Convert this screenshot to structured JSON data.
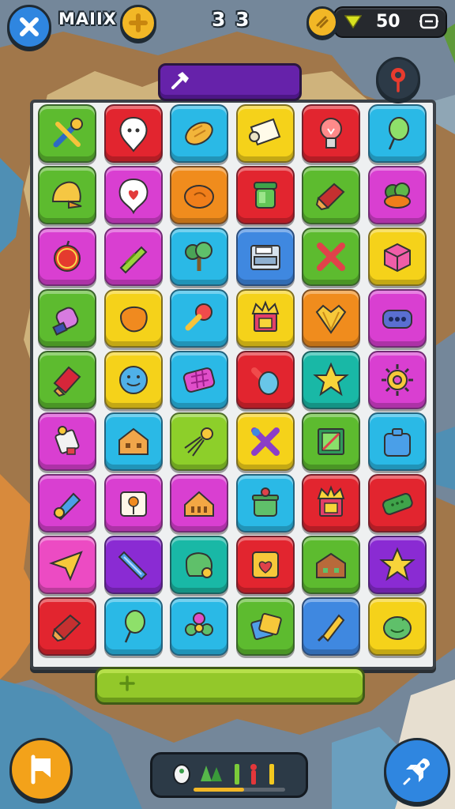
{
  "hud": {
    "title": "MAIIX",
    "score": "3 3",
    "coins": "50"
  },
  "colors": {
    "green": "#5dbb2f",
    "red": "#e2252f",
    "cyan": "#2ab9e6",
    "yellow": "#f5d21a",
    "orange": "#f08c1d",
    "magenta": "#d93fd1",
    "blue": "#3f88e0",
    "teal": "#19b8a6",
    "purple": "#8a2bd3",
    "lime": "#8dcf2a",
    "pink": "#ec4bc3"
  },
  "board": {
    "rows": [
      [
        {
          "color": "green",
          "icon": "wrench-icon"
        },
        {
          "color": "red",
          "icon": "ghost-bubble-icon"
        },
        {
          "color": "cyan",
          "icon": "bread-icon"
        },
        {
          "color": "yellow",
          "icon": "scroll-icon"
        },
        {
          "color": "red",
          "icon": "lightbulb-icon"
        },
        {
          "color": "cyan",
          "icon": "balloon-icon"
        }
      ],
      [
        {
          "color": "green",
          "icon": "helmet-icon"
        },
        {
          "color": "magenta",
          "icon": "heart-bubble-icon"
        },
        {
          "color": "orange",
          "icon": "bun-icon"
        },
        {
          "color": "red",
          "icon": "jar-icon"
        },
        {
          "color": "green",
          "icon": "candy-icon"
        },
        {
          "color": "magenta",
          "icon": "bush-icon"
        }
      ],
      [
        {
          "color": "magenta",
          "icon": "apple-icon"
        },
        {
          "color": "magenta",
          "icon": "crayon-icon"
        },
        {
          "color": "cyan",
          "icon": "tree-icon"
        },
        {
          "color": "blue",
          "icon": "cabinet-icon"
        },
        {
          "color": "green",
          "icon": "cross-icon"
        },
        {
          "color": "yellow",
          "icon": "cube-icon"
        }
      ],
      [
        {
          "color": "green",
          "icon": "potion-icon"
        },
        {
          "color": "yellow",
          "icon": "cookie-icon"
        },
        {
          "color": "cyan",
          "icon": "key-icon"
        },
        {
          "color": "yellow",
          "icon": "crown-box-icon"
        },
        {
          "color": "orange",
          "icon": "crown-icon"
        },
        {
          "color": "magenta",
          "icon": "dots-icon"
        }
      ],
      [
        {
          "color": "green",
          "icon": "cup-icon"
        },
        {
          "color": "yellow",
          "icon": "smiley-icon"
        },
        {
          "color": "cyan",
          "icon": "waffle-icon"
        },
        {
          "color": "red",
          "icon": "hammer-icon"
        },
        {
          "color": "teal",
          "icon": "star-icon"
        },
        {
          "color": "magenta",
          "icon": "gear-icon"
        }
      ],
      [
        {
          "color": "magenta",
          "icon": "robot-icon"
        },
        {
          "color": "cyan",
          "icon": "house-icon"
        },
        {
          "color": "lime",
          "icon": "badminton-icon"
        },
        {
          "color": "yellow",
          "icon": "wrench-cross-icon"
        },
        {
          "color": "green",
          "icon": "frame-icon"
        },
        {
          "color": "cyan",
          "icon": "box-icon"
        }
      ],
      [
        {
          "color": "magenta",
          "icon": "bottle-icon"
        },
        {
          "color": "magenta",
          "icon": "sign-icon"
        },
        {
          "color": "magenta",
          "icon": "cake-icon"
        },
        {
          "color": "cyan",
          "icon": "pot-icon"
        },
        {
          "color": "red",
          "icon": "crown-box-icon"
        },
        {
          "color": "red",
          "icon": "bandage-icon"
        }
      ],
      [
        {
          "color": "pink",
          "icon": "plane-icon"
        },
        {
          "color": "purple",
          "icon": "tube-icon"
        },
        {
          "color": "teal",
          "icon": "blob-icon"
        },
        {
          "color": "red",
          "icon": "heart-box-icon"
        },
        {
          "color": "green",
          "icon": "chest-icon"
        },
        {
          "color": "purple",
          "icon": "star-icon"
        }
      ],
      [
        {
          "color": "red",
          "icon": "candy-icon"
        },
        {
          "color": "cyan",
          "icon": "balloon-icon"
        },
        {
          "color": "cyan",
          "icon": "flower-icon"
        },
        {
          "color": "green",
          "icon": "tags-icon"
        },
        {
          "color": "blue",
          "icon": "rocket-icon"
        },
        {
          "color": "yellow",
          "icon": "face-icon"
        }
      ]
    ]
  },
  "bottom_bar": {
    "progress": 0.55,
    "progress_color": "#f2b726"
  }
}
